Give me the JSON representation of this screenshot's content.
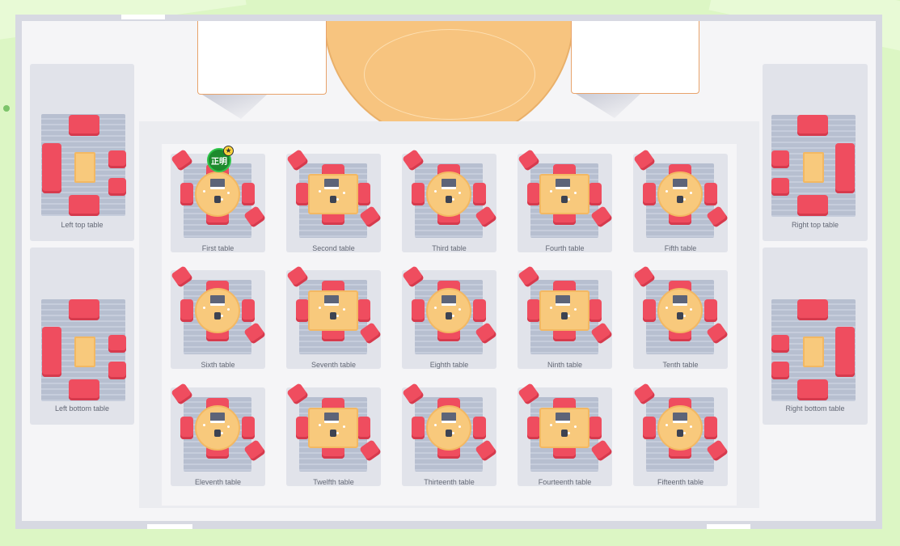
{
  "colors": {
    "background": "#dcf6c4",
    "chair": "#ef4d5f",
    "table": "#f8c97c",
    "rug": "#b7bfd0",
    "avatar": "#1d8a2d"
  },
  "avatar": {
    "name": "正明",
    "badge_icon": "star-icon"
  },
  "side_tables": {
    "left_top": "Left top table",
    "left_bottom": "Left bottom table",
    "right_top": "Right top table",
    "right_bottom": "Right bottom table"
  },
  "tables": [
    {
      "label": "First table",
      "shape": "round"
    },
    {
      "label": "Second table",
      "shape": "rect"
    },
    {
      "label": "Third table",
      "shape": "round"
    },
    {
      "label": "Fourth table",
      "shape": "rect"
    },
    {
      "label": "Fifth table",
      "shape": "round"
    },
    {
      "label": "Sixth table",
      "shape": "round"
    },
    {
      "label": "Seventh table",
      "shape": "rect"
    },
    {
      "label": "Eighth table",
      "shape": "round"
    },
    {
      "label": "Ninth table",
      "shape": "rect"
    },
    {
      "label": "Tenth table",
      "shape": "round"
    },
    {
      "label": "Eleventh table",
      "shape": "round"
    },
    {
      "label": "Twelfth table",
      "shape": "rect"
    },
    {
      "label": "Thirteenth table",
      "shape": "round"
    },
    {
      "label": "Fourteenth table",
      "shape": "rect"
    },
    {
      "label": "Fifteenth table",
      "shape": "round"
    }
  ]
}
